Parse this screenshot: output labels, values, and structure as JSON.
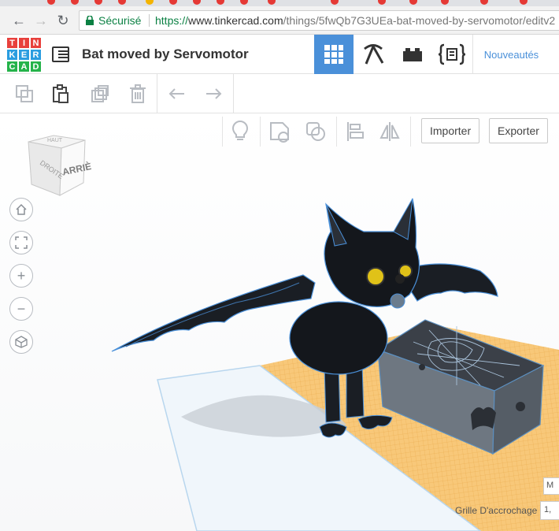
{
  "browser": {
    "secure_label": "Sécurisé",
    "url_protocol": "https://",
    "url_host": "www.tinkercad.com",
    "url_path": "/things/5fwQb7G3UEa-bat-moved-by-servomotor/editv2"
  },
  "app": {
    "logo_letters": [
      "T",
      "I",
      "N",
      "K",
      "E",
      "R",
      "C",
      "A",
      "D"
    ],
    "logo_colors": [
      "#e8403c",
      "#e8403c",
      "#e8403c",
      "#2a9de0",
      "#2a9de0",
      "#2a9de0",
      "#25b34a",
      "#25b34a",
      "#25b34a"
    ],
    "document_title": "Bat moved by Servomotor",
    "news_label": "Nouveautés",
    "header_tabs": [
      {
        "name": "3d-design",
        "icon": "grid-icon",
        "active": true
      },
      {
        "name": "codeblocks",
        "icon": "pickaxe-icon",
        "active": false
      },
      {
        "name": "bricks",
        "icon": "brick-icon",
        "active": false
      },
      {
        "name": "lessons",
        "icon": "code-brackets-icon",
        "active": false
      }
    ]
  },
  "toolbar": {
    "tools": [
      "copy-icon",
      "paste-icon",
      "duplicate-icon",
      "trash-icon",
      "undo-icon",
      "redo-icon"
    ]
  },
  "viewport": {
    "view_cube_label": "ARRIÈRE",
    "import_label": "Importer",
    "export_label": "Exporter",
    "grid_label": "Grille D'accrochage",
    "grid_value": "1,",
    "edit_label": "M"
  },
  "colors": {
    "accent": "#4a90d9",
    "workplane": "#f7c06b",
    "bat": "#1a1e24",
    "bat_outline": "#4a90d9",
    "box": "#6b7480"
  }
}
